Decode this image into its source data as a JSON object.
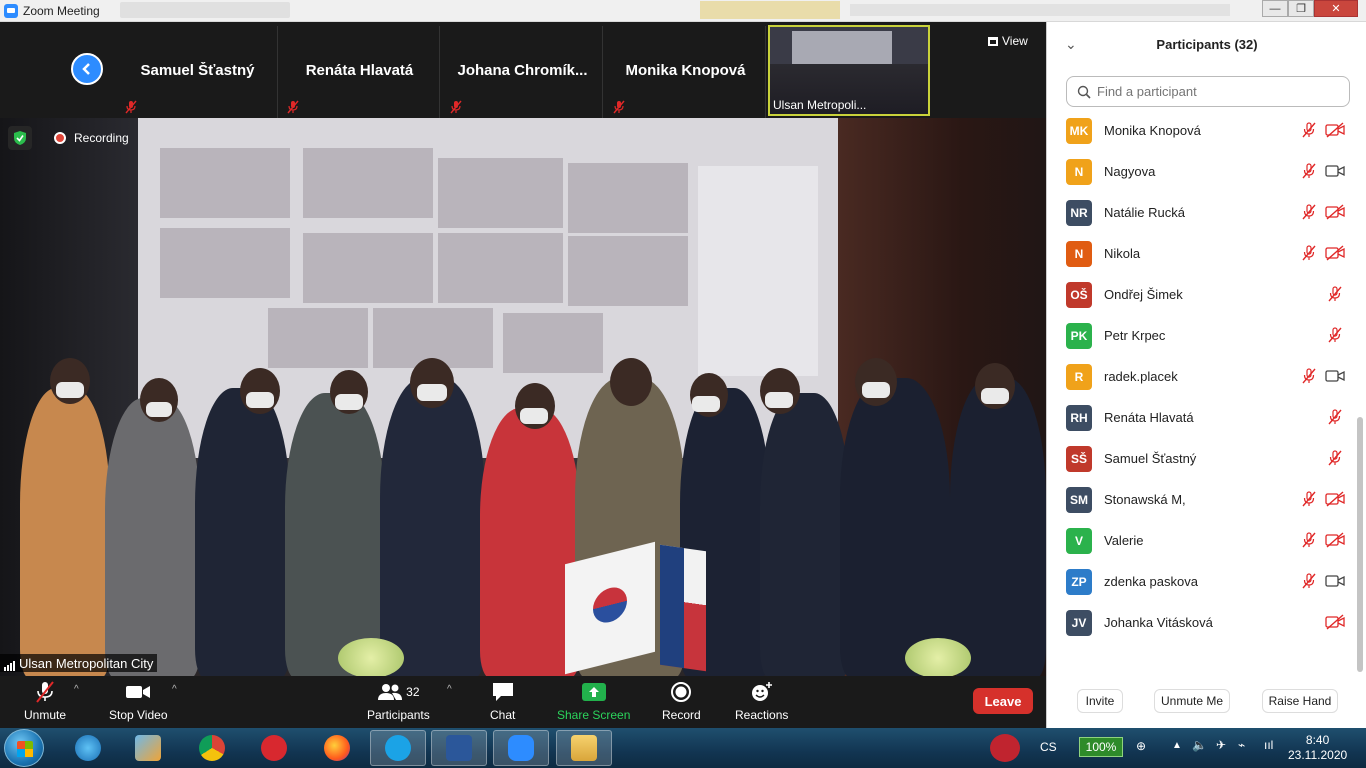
{
  "window": {
    "title": "Zoom Meeting"
  },
  "view_label": "View",
  "strip": {
    "tiles": [
      {
        "name": "Samuel Šťastný"
      },
      {
        "name": "Renáta Hlavatá"
      },
      {
        "name": "Johana  Chromík..."
      },
      {
        "name": "Monika Knopová"
      }
    ],
    "thumb_label": "Ulsan Metropoli..."
  },
  "recording_label": "Recording",
  "speaker_label": "Ulsan Metropolitan City",
  "toolbar": {
    "unmute": "Unmute",
    "stop_video": "Stop Video",
    "participants": "Participants",
    "participants_count": "32",
    "chat": "Chat",
    "share_screen": "Share Screen",
    "record": "Record",
    "reactions": "Reactions",
    "leave": "Leave"
  },
  "panel": {
    "title": "Participants (32)",
    "search_placeholder": "Find a participant",
    "participants": [
      {
        "initials": "MK",
        "name": "Monika Knopová",
        "color": "#f0a21a",
        "mic": "muted",
        "video": "off"
      },
      {
        "initials": "N",
        "name": "Nagyova",
        "color": "#f0a21a",
        "mic": "muted",
        "video": "on"
      },
      {
        "initials": "NR",
        "name": "Natálie Rucká",
        "color": "#3d4d63",
        "mic": "muted",
        "video": "off"
      },
      {
        "initials": "N",
        "name": "Nikola",
        "color": "#e05c12",
        "mic": "muted",
        "video": "off"
      },
      {
        "initials": "OŠ",
        "name": "Ondřej Šimek",
        "color": "#c0392b",
        "mic": "muted",
        "video": "none"
      },
      {
        "initials": "PK",
        "name": "Petr Krpec",
        "color": "#2bb24c",
        "mic": "muted",
        "video": "none"
      },
      {
        "initials": "R",
        "name": "radek.placek",
        "color": "#f0a21a",
        "mic": "muted",
        "video": "on"
      },
      {
        "initials": "RH",
        "name": "Renáta Hlavatá",
        "color": "#3d4d63",
        "mic": "muted",
        "video": "none"
      },
      {
        "initials": "SŠ",
        "name": "Samuel Šťastný",
        "color": "#c0392b",
        "mic": "muted",
        "video": "none"
      },
      {
        "initials": "SM",
        "name": "Stonawská M,",
        "color": "#3d4d63",
        "mic": "muted",
        "video": "off"
      },
      {
        "initials": "V",
        "name": "Valerie",
        "color": "#2bb24c",
        "mic": "muted",
        "video": "off"
      },
      {
        "initials": "ZP",
        "name": "zdenka paskova",
        "color": "#2d7cc9",
        "mic": "muted",
        "video": "on"
      },
      {
        "initials": "JV",
        "name": "Johanka Vitásková",
        "color": "#3d4d63",
        "mic": "none",
        "video": "off"
      }
    ],
    "invite": "Invite",
    "unmute_me": "Unmute Me",
    "raise_hand": "Raise Hand"
  },
  "taskbar": {
    "language": "CS",
    "battery": "100%",
    "time": "8:40",
    "date": "23.11.2020"
  },
  "colors": {
    "accent": "#2d8cff",
    "danger": "#e02828",
    "share": "#22b14c"
  }
}
